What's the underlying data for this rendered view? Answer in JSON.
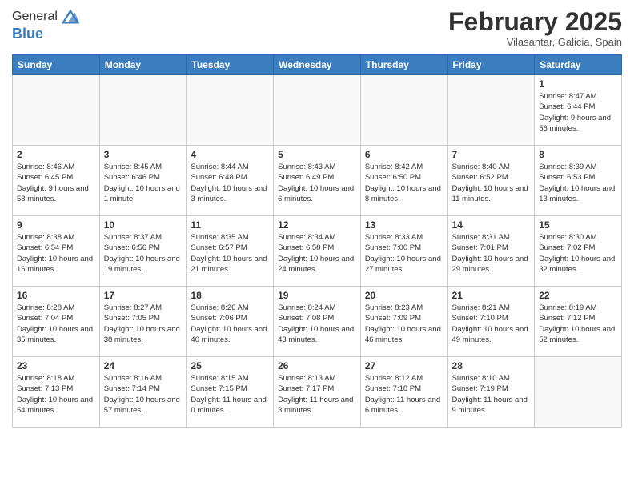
{
  "header": {
    "logo_general": "General",
    "logo_blue": "Blue",
    "month_title": "February 2025",
    "location": "Vilasantar, Galicia, Spain"
  },
  "days_of_week": [
    "Sunday",
    "Monday",
    "Tuesday",
    "Wednesday",
    "Thursday",
    "Friday",
    "Saturday"
  ],
  "weeks": [
    [
      {
        "day": "",
        "info": ""
      },
      {
        "day": "",
        "info": ""
      },
      {
        "day": "",
        "info": ""
      },
      {
        "day": "",
        "info": ""
      },
      {
        "day": "",
        "info": ""
      },
      {
        "day": "",
        "info": ""
      },
      {
        "day": "1",
        "info": "Sunrise: 8:47 AM\nSunset: 6:44 PM\nDaylight: 9 hours and 56 minutes."
      }
    ],
    [
      {
        "day": "2",
        "info": "Sunrise: 8:46 AM\nSunset: 6:45 PM\nDaylight: 9 hours and 58 minutes."
      },
      {
        "day": "3",
        "info": "Sunrise: 8:45 AM\nSunset: 6:46 PM\nDaylight: 10 hours and 1 minute."
      },
      {
        "day": "4",
        "info": "Sunrise: 8:44 AM\nSunset: 6:48 PM\nDaylight: 10 hours and 3 minutes."
      },
      {
        "day": "5",
        "info": "Sunrise: 8:43 AM\nSunset: 6:49 PM\nDaylight: 10 hours and 6 minutes."
      },
      {
        "day": "6",
        "info": "Sunrise: 8:42 AM\nSunset: 6:50 PM\nDaylight: 10 hours and 8 minutes."
      },
      {
        "day": "7",
        "info": "Sunrise: 8:40 AM\nSunset: 6:52 PM\nDaylight: 10 hours and 11 minutes."
      },
      {
        "day": "8",
        "info": "Sunrise: 8:39 AM\nSunset: 6:53 PM\nDaylight: 10 hours and 13 minutes."
      }
    ],
    [
      {
        "day": "9",
        "info": "Sunrise: 8:38 AM\nSunset: 6:54 PM\nDaylight: 10 hours and 16 minutes."
      },
      {
        "day": "10",
        "info": "Sunrise: 8:37 AM\nSunset: 6:56 PM\nDaylight: 10 hours and 19 minutes."
      },
      {
        "day": "11",
        "info": "Sunrise: 8:35 AM\nSunset: 6:57 PM\nDaylight: 10 hours and 21 minutes."
      },
      {
        "day": "12",
        "info": "Sunrise: 8:34 AM\nSunset: 6:58 PM\nDaylight: 10 hours and 24 minutes."
      },
      {
        "day": "13",
        "info": "Sunrise: 8:33 AM\nSunset: 7:00 PM\nDaylight: 10 hours and 27 minutes."
      },
      {
        "day": "14",
        "info": "Sunrise: 8:31 AM\nSunset: 7:01 PM\nDaylight: 10 hours and 29 minutes."
      },
      {
        "day": "15",
        "info": "Sunrise: 8:30 AM\nSunset: 7:02 PM\nDaylight: 10 hours and 32 minutes."
      }
    ],
    [
      {
        "day": "16",
        "info": "Sunrise: 8:28 AM\nSunset: 7:04 PM\nDaylight: 10 hours and 35 minutes."
      },
      {
        "day": "17",
        "info": "Sunrise: 8:27 AM\nSunset: 7:05 PM\nDaylight: 10 hours and 38 minutes."
      },
      {
        "day": "18",
        "info": "Sunrise: 8:26 AM\nSunset: 7:06 PM\nDaylight: 10 hours and 40 minutes."
      },
      {
        "day": "19",
        "info": "Sunrise: 8:24 AM\nSunset: 7:08 PM\nDaylight: 10 hours and 43 minutes."
      },
      {
        "day": "20",
        "info": "Sunrise: 8:23 AM\nSunset: 7:09 PM\nDaylight: 10 hours and 46 minutes."
      },
      {
        "day": "21",
        "info": "Sunrise: 8:21 AM\nSunset: 7:10 PM\nDaylight: 10 hours and 49 minutes."
      },
      {
        "day": "22",
        "info": "Sunrise: 8:19 AM\nSunset: 7:12 PM\nDaylight: 10 hours and 52 minutes."
      }
    ],
    [
      {
        "day": "23",
        "info": "Sunrise: 8:18 AM\nSunset: 7:13 PM\nDaylight: 10 hours and 54 minutes."
      },
      {
        "day": "24",
        "info": "Sunrise: 8:16 AM\nSunset: 7:14 PM\nDaylight: 10 hours and 57 minutes."
      },
      {
        "day": "25",
        "info": "Sunrise: 8:15 AM\nSunset: 7:15 PM\nDaylight: 11 hours and 0 minutes."
      },
      {
        "day": "26",
        "info": "Sunrise: 8:13 AM\nSunset: 7:17 PM\nDaylight: 11 hours and 3 minutes."
      },
      {
        "day": "27",
        "info": "Sunrise: 8:12 AM\nSunset: 7:18 PM\nDaylight: 11 hours and 6 minutes."
      },
      {
        "day": "28",
        "info": "Sunrise: 8:10 AM\nSunset: 7:19 PM\nDaylight: 11 hours and 9 minutes."
      },
      {
        "day": "",
        "info": ""
      }
    ]
  ]
}
